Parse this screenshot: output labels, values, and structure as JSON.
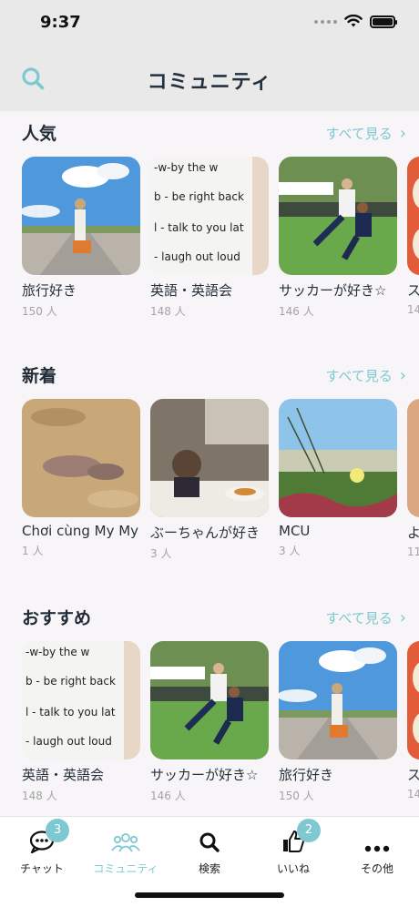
{
  "status": {
    "time": "9:37"
  },
  "nav": {
    "title": "コミュニティ",
    "search_icon": "search-icon"
  },
  "sections": [
    {
      "title": "人気",
      "see_all": "すべて見る",
      "cards": [
        {
          "name": "旅行好き",
          "members": "150 人",
          "image": "girl-on-road-photo"
        },
        {
          "name": "英語・英語会",
          "members": "148 人",
          "image": "english-whiteboard-photo"
        },
        {
          "name": "サッカーが好き☆",
          "members": "146 人",
          "image": "soccer-tackle-photo"
        },
        {
          "name": "ス",
          "members": "14",
          "image": "lanterns-photo"
        }
      ]
    },
    {
      "title": "新着",
      "see_all": "すべて見る",
      "cards": [
        {
          "name": "Chơi cùng My My",
          "members": "1 人",
          "image": "pigs-in-dirt-photo"
        },
        {
          "name": "ぶーちゃんが好き",
          "members": "3 人",
          "image": "child-at-restaurant-photo"
        },
        {
          "name": "MCU",
          "members": "3 人",
          "image": "beach-grass-photo"
        },
        {
          "name": "よ",
          "members": "11",
          "image": "partial-photo"
        }
      ]
    },
    {
      "title": "おすすめ",
      "see_all": "すべて見る",
      "cards": [
        {
          "name": "英語・英語会",
          "members": "148 人",
          "image": "english-whiteboard-photo"
        },
        {
          "name": "サッカーが好き☆",
          "members": "146 人",
          "image": "soccer-tackle-photo"
        },
        {
          "name": "旅行好き",
          "members": "150 人",
          "image": "girl-on-road-photo"
        },
        {
          "name": "ス",
          "members": "14",
          "image": "lanterns-photo"
        }
      ]
    }
  ],
  "whiteboard_lines": [
    "-w-by the w",
    "b - be right back",
    "l - talk to you lat",
    "- laugh out loud"
  ],
  "tabs": [
    {
      "label": "チャット",
      "icon": "chat-bubble-icon",
      "badge": "3"
    },
    {
      "label": "コミュニティ",
      "icon": "community-people-icon",
      "active": true
    },
    {
      "label": "検索",
      "icon": "search-icon"
    },
    {
      "label": "いいね",
      "icon": "thumbs-up-icon",
      "badge": "2"
    },
    {
      "label": "その他",
      "icon": "more-dots-icon"
    }
  ],
  "colors": {
    "accent": "#7ec9d1",
    "nav_background": "#e9e9ea",
    "page_background": "#f7f5f7",
    "title_text": "#23313f"
  }
}
